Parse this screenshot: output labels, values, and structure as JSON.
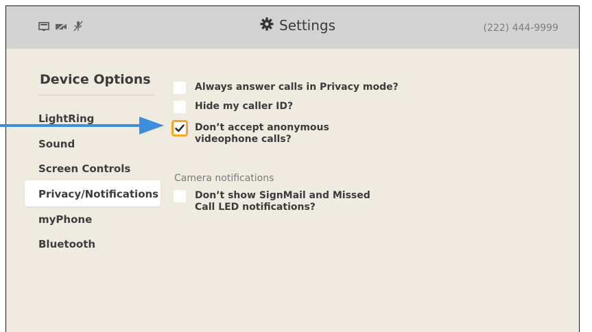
{
  "header": {
    "title": "Settings",
    "phone_number": "(222) 444-9999",
    "title_icon": "gear-icon",
    "status_icons": [
      "network-icon",
      "video-off-icon",
      "mic-off-icon"
    ]
  },
  "sidebar": {
    "heading": "Device Options",
    "items": [
      {
        "label": "LightRing"
      },
      {
        "label": "Sound"
      },
      {
        "label": "Screen Controls"
      },
      {
        "label": "Privacy/Notifications",
        "selected": true
      },
      {
        "label": "myPhone"
      },
      {
        "label": "Bluetooth"
      }
    ]
  },
  "options": [
    {
      "label": "Always answer calls in Privacy mode?",
      "checked": false
    },
    {
      "label": "Hide my caller ID?",
      "checked": false
    },
    {
      "label_line1": "Don’t accept anonymous",
      "label_line2": "videophone calls?",
      "checked": true
    }
  ],
  "camera_section": {
    "heading": "Camera notifications",
    "option": {
      "label_line1": "Don’t show SignMail and Missed",
      "label_line2": "Call LED notifications?",
      "checked": false
    }
  },
  "colors": {
    "background": "#f0ebe0",
    "topbar": "#d3d3d3",
    "focus_outline": "#f6a524",
    "callout_arrow": "#3e8ee0"
  }
}
